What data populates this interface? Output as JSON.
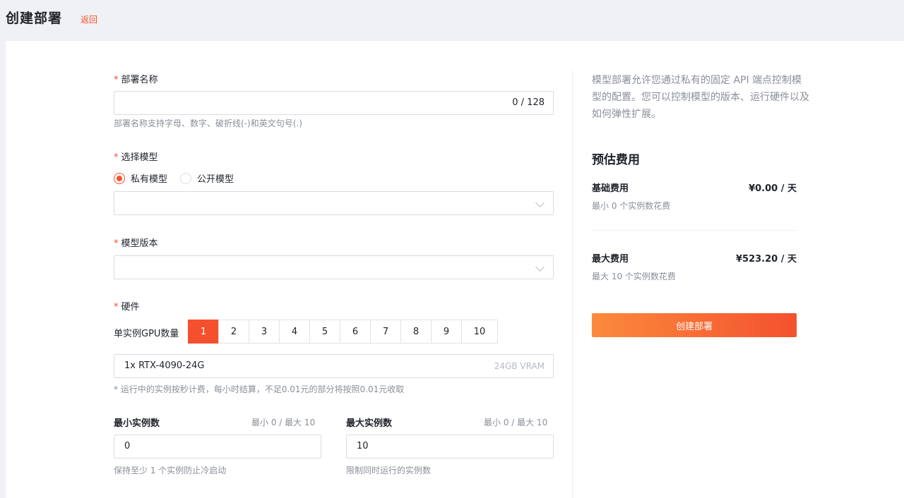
{
  "header": {
    "title": "创建部署",
    "back": "返回"
  },
  "form": {
    "name": {
      "label": "部署名称",
      "required_mark": "*",
      "value": "",
      "counter": "0 / 128",
      "hint": "部署名称支持字母、数字、破折线(-)和英文句号(.)"
    },
    "model": {
      "label": "选择模型",
      "required_mark": "*",
      "options": [
        "私有模型",
        "公开模型"
      ],
      "selected": "私有模型",
      "value": ""
    },
    "version": {
      "label": "模型版本",
      "required_mark": "*",
      "value": ""
    },
    "hardware": {
      "label": "硬件",
      "required_mark": "*",
      "gpu_label": "单实例GPU数量",
      "gpu_counts": [
        "1",
        "2",
        "3",
        "4",
        "5",
        "6",
        "7",
        "8",
        "9",
        "10"
      ],
      "gpu_selected": "1",
      "gpu_model": "1x RTX-4090-24G",
      "vram": "24GB VRAM",
      "billing_note": "* 运行中的实例按秒计费，每小时结算，不足0.01元的部分将按照0.01元收取"
    },
    "min_instances": {
      "label": "最小实例数",
      "range": "最小 0 / 最大 10",
      "value": "0",
      "hint": "保持至少 1 个实例防止冷启动"
    },
    "max_instances": {
      "label": "最大实例数",
      "range": "最小 0 / 最大 10",
      "value": "10",
      "hint": "限制同时运行的实例数"
    }
  },
  "side": {
    "description": "模型部署允许您通过私有的固定 API 端点控制模型的配置。您可以控制模型的版本、运行硬件以及如何弹性扩展。",
    "estimate_title": "预估费用",
    "base_fee": {
      "name": "基础费用",
      "value": "¥0.00 / 天",
      "note": "最小 0 个实例数花费"
    },
    "max_fee": {
      "name": "最大费用",
      "value": "¥523.20 / 天",
      "note": "最大 10 个实例数花费"
    },
    "create_button": "创建部署"
  },
  "colors": {
    "accent": "#f5502d",
    "muted": "#8a8f99",
    "border": "#d9dce1"
  }
}
